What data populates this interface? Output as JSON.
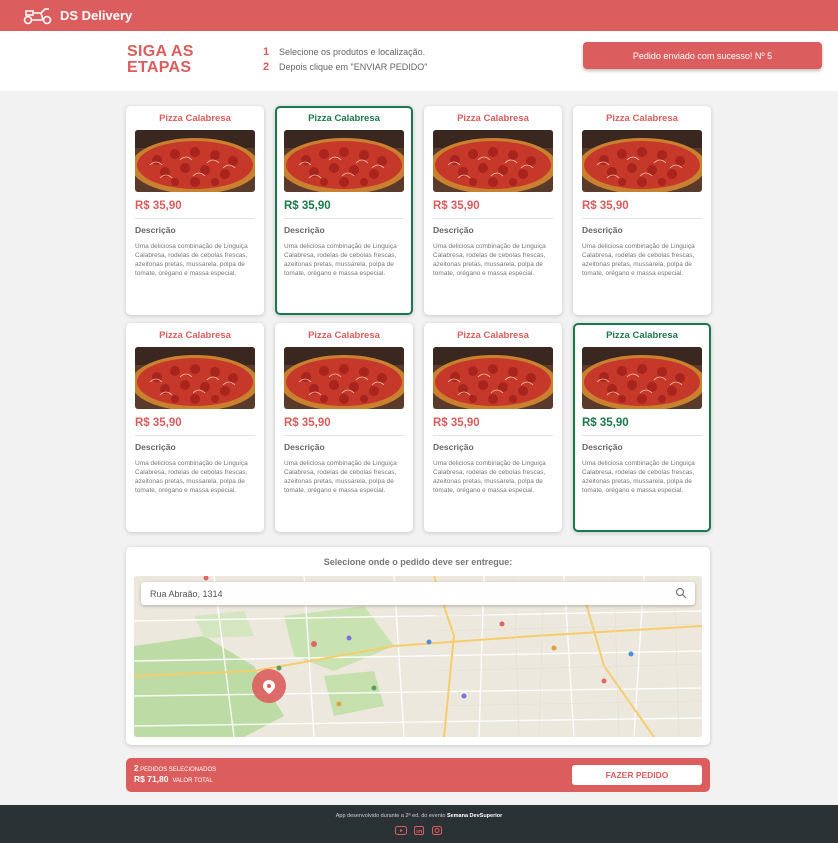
{
  "app": {
    "name": "DS Delivery"
  },
  "steps": {
    "title_line1": "SIGA AS",
    "title_line2": "ETAPAS",
    "items": [
      {
        "num": "1",
        "text": "Selecione os produtos e localização."
      },
      {
        "num": "2",
        "text": "Depois clique em \"ENVIAR PEDIDO\""
      }
    ]
  },
  "status_message": "Pedido enviado com sucesso! Nº 5",
  "products": [
    {
      "name": "Pizza Calabresa",
      "price": "R$ 35,90",
      "desc_label": "Descrição",
      "description": "Uma deliciosa combinação de Linguiça Calabresa, rodelas de cebolas frescas, azeitonas pretas, mussarela, polpa de tomate, orégano e massa especial.",
      "selected": false
    },
    {
      "name": "Pizza Calabresa",
      "price": "R$ 35,90",
      "desc_label": "Descrição",
      "description": "Uma deliciosa combinação de Linguiça Calabresa, rodelas de cebolas frescas, azeitonas pretas, mussarela, polpa de tomate, orégano e massa especial.",
      "selected": true
    },
    {
      "name": "Pizza Calabresa",
      "price": "R$ 35,90",
      "desc_label": "Descrição",
      "description": "Uma deliciosa combinação de Linguiça Calabresa, rodelas de cebolas frescas, azeitonas pretas, mussarela, polpa de tomate, orégano e massa especial.",
      "selected": false
    },
    {
      "name": "Pizza Calabresa",
      "price": "R$ 35,90",
      "desc_label": "Descrição",
      "description": "Uma deliciosa combinação de Linguiça Calabresa, rodelas de cebolas frescas, azeitonas pretas, mussarela, polpa de tomate, orégano e massa especial.",
      "selected": false
    },
    {
      "name": "Pizza Calabresa",
      "price": "R$ 35,90",
      "desc_label": "Descrição",
      "description": "Uma deliciosa combinação de Linguiça Calabresa, rodelas de cebolas frescas, azeitonas pretas, mussarela, polpa de tomate, orégano e massa especial.",
      "selected": false
    },
    {
      "name": "Pizza Calabresa",
      "price": "R$ 35,90",
      "desc_label": "Descrição",
      "description": "Uma deliciosa combinação de Linguiça Calabresa, rodelas de cebolas frescas, azeitonas pretas, mussarela, polpa de tomate, orégano e massa especial.",
      "selected": false
    },
    {
      "name": "Pizza Calabresa",
      "price": "R$ 35,90",
      "desc_label": "Descrição",
      "description": "Uma deliciosa combinação de Linguiça Calabresa, rodelas de cebolas frescas, azeitonas pretas, mussarela, polpa de tomate, orégano e massa especial.",
      "selected": false
    },
    {
      "name": "Pizza Calabresa",
      "price": "R$ 35,90",
      "desc_label": "Descrição",
      "description": "Uma deliciosa combinação de Linguiça Calabresa, rodelas de cebolas frescas, azeitonas pretas, mussarela, polpa de tomate, orégano e massa especial.",
      "selected": true
    }
  ],
  "map": {
    "title": "Selecione onde o pedido deve ser entregue:",
    "search_value": "Rua Abraão, 1314",
    "search_icon": "search-icon"
  },
  "order_summary": {
    "items_count": "2",
    "items_label": "PEDIDOS SELECIONADOS",
    "total_value": "R$ 71,80",
    "total_label": "VALOR TOTAL",
    "button_label": "FAZER PEDIDO"
  },
  "footer": {
    "text": "App desenvolvido durante a 2ª ed. do evento",
    "highlight": "Semana DevSuperior"
  },
  "colors": {
    "brand": "#db5d5d",
    "selected": "#1b7a4a",
    "footer_bg": "#2b3236"
  }
}
